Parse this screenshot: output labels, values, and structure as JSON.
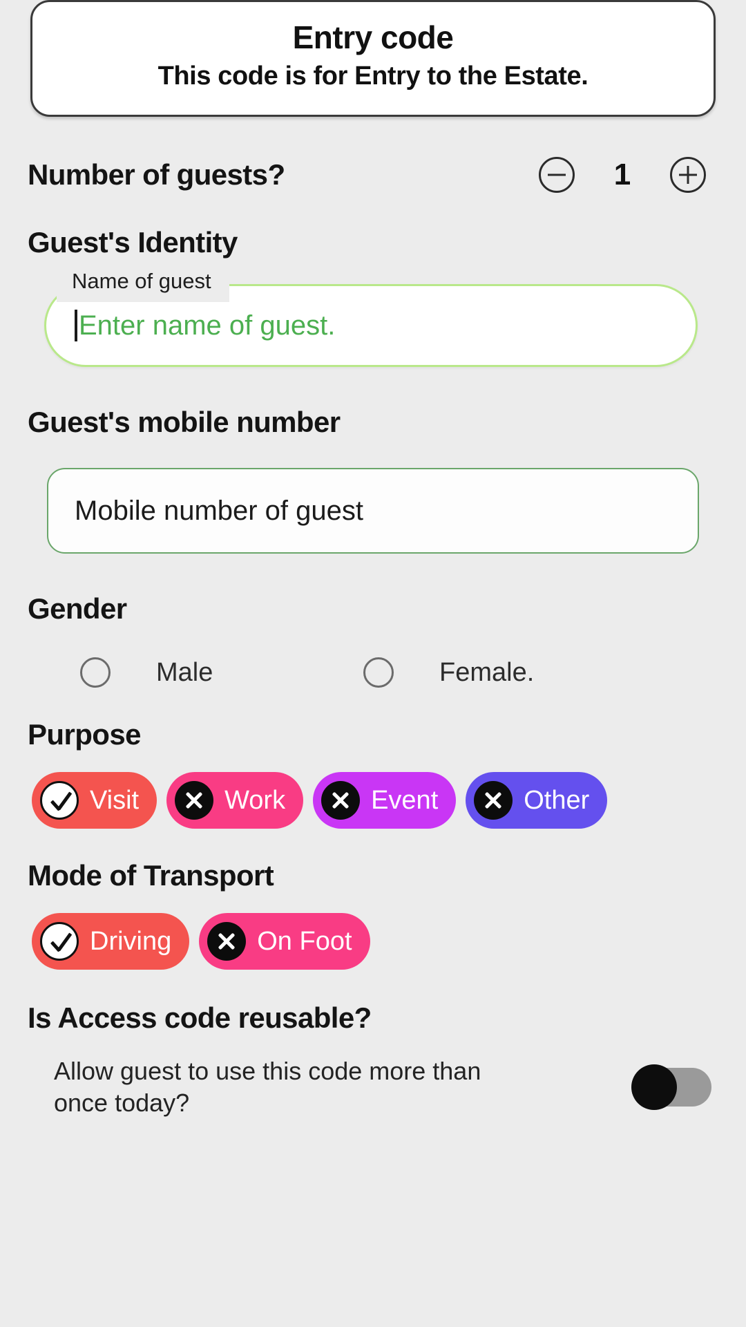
{
  "header": {
    "title": "Entry code",
    "subtitle": "This code is for Entry to the Estate."
  },
  "guests": {
    "label": "Number of guests?",
    "value": "1",
    "decrement_icon": "minus-circle-icon",
    "increment_icon": "plus-circle-icon"
  },
  "identity": {
    "heading": "Guest's Identity",
    "name_field": {
      "float_label": "Name of guest",
      "placeholder": "Enter name of guest.",
      "value": "",
      "focused": true,
      "border_color": "#b9e88a",
      "text_color": "#4caf50"
    }
  },
  "mobile": {
    "heading": "Guest's mobile number",
    "placeholder": "Mobile number of guest",
    "value": "",
    "border_color": "#6aa66a"
  },
  "gender": {
    "heading": "Gender",
    "options": [
      {
        "label": "Male",
        "selected": false
      },
      {
        "label": "Female.",
        "selected": false
      }
    ]
  },
  "purpose": {
    "heading": "Purpose",
    "chips": [
      {
        "label": "Visit",
        "selected": true,
        "icon": "check-circle-icon",
        "color": "#f4544f"
      },
      {
        "label": "Work",
        "selected": false,
        "icon": "x-circle-icon",
        "color": "#f93c84"
      },
      {
        "label": "Event",
        "selected": false,
        "icon": "x-circle-icon",
        "color": "#c936f5"
      },
      {
        "label": "Other",
        "selected": false,
        "icon": "x-circle-icon",
        "color": "#6450ee"
      }
    ]
  },
  "transport": {
    "heading": "Mode of Transport",
    "chips": [
      {
        "label": "Driving",
        "selected": true,
        "icon": "check-circle-icon",
        "color": "#f4544f"
      },
      {
        "label": "On Foot",
        "selected": false,
        "icon": "x-circle-icon",
        "color": "#f93c84"
      }
    ]
  },
  "reusable": {
    "heading": "Is Access code reusable?",
    "description": "Allow guest to use this code more than once today?",
    "toggle_on": false,
    "toggle_track_color": "#9a9a9a",
    "toggle_thumb_color": "#0d0d0d"
  }
}
